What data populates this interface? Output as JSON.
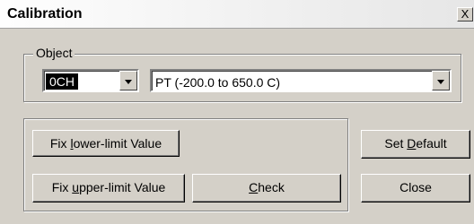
{
  "window": {
    "title": "Calibration",
    "close_label": "X"
  },
  "object_group": {
    "label": "Object",
    "channel_value": "0CH",
    "sensor_value": "PT (-200.0 to 650.0 C)"
  },
  "buttons": {
    "fix_lower": {
      "pre": "Fix ",
      "key": "l",
      "post": "ower-limit Value"
    },
    "fix_upper": {
      "pre": "Fix ",
      "key": "u",
      "post": "pper-limit Value"
    },
    "check": {
      "pre": "",
      "key": "C",
      "post": "heck"
    },
    "set_default": {
      "pre": "Set ",
      "key": "D",
      "post": "efault"
    },
    "close": {
      "pre": "Close",
      "key": "",
      "post": ""
    }
  }
}
